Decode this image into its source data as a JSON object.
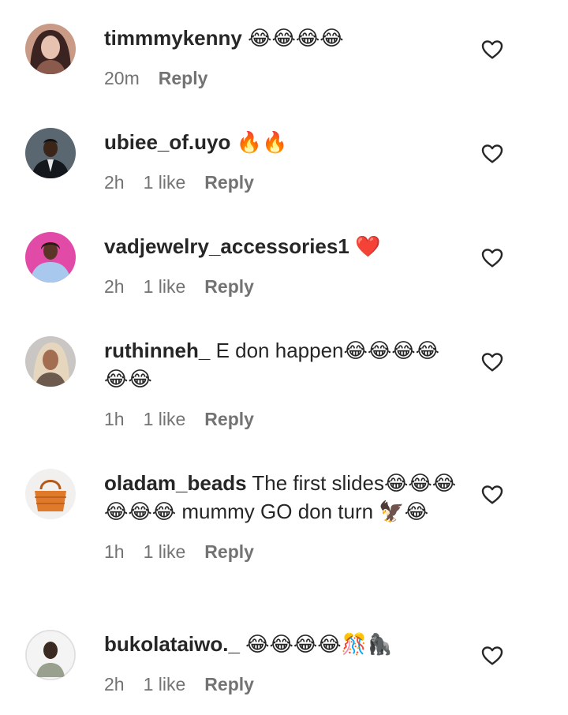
{
  "comments": [
    {
      "username": "timmmykenny",
      "text": " 😂😂😂😂",
      "time": "20m",
      "likes": "",
      "reply_label": "Reply",
      "avatar": {
        "bg": "#c99a86",
        "fg": "#3a2320",
        "accent": "#e8c2b0"
      }
    },
    {
      "username": "ubiee_of.uyo",
      "text": " 🔥🔥",
      "time": "2h",
      "likes": "1 like",
      "reply_label": "Reply",
      "avatar": {
        "bg": "#5a6670",
        "fg": "#14181c",
        "accent": "#2c3540"
      }
    },
    {
      "username": "vadjewelry_accessories1",
      "text": " ❤️",
      "time": "2h",
      "likes": "1 like",
      "reply_label": "Reply",
      "avatar": {
        "bg": "#e24aa7",
        "fg": "#4c2a2a",
        "accent": "#a9c8ee"
      }
    },
    {
      "username": "ruthinneh_",
      "text": " E don happen😂😂😂😂😂😂",
      "time": "1h",
      "likes": "1 like",
      "reply_label": "Reply",
      "avatar": {
        "bg": "#c9c6c3",
        "fg": "#e6d6be",
        "accent": "#6c5a4e"
      }
    },
    {
      "username": "oladam_beads",
      "text": " The first slides😂😂😂😂😂😂 mummy GO don turn 🦅😂",
      "time": "1h",
      "likes": "1 like",
      "reply_label": "Reply",
      "avatar": {
        "bg": "#f2f0ee",
        "fg": "#e07a2b",
        "accent": "#b4581a"
      }
    },
    {
      "username": "bukolataiwo._",
      "text": " 😂😂😂😂🎊🦍",
      "time": "2h",
      "likes": "1 like",
      "reply_label": "Reply",
      "avatar": {
        "bg": "#f4f4f4",
        "fg": "#3a2a22",
        "accent": "#9aa08e"
      }
    }
  ],
  "icons": {
    "like": "heart-outline-icon"
  },
  "colors": {
    "username": "#262626",
    "text": "#262626",
    "meta": "#737373",
    "background": "#ffffff"
  }
}
